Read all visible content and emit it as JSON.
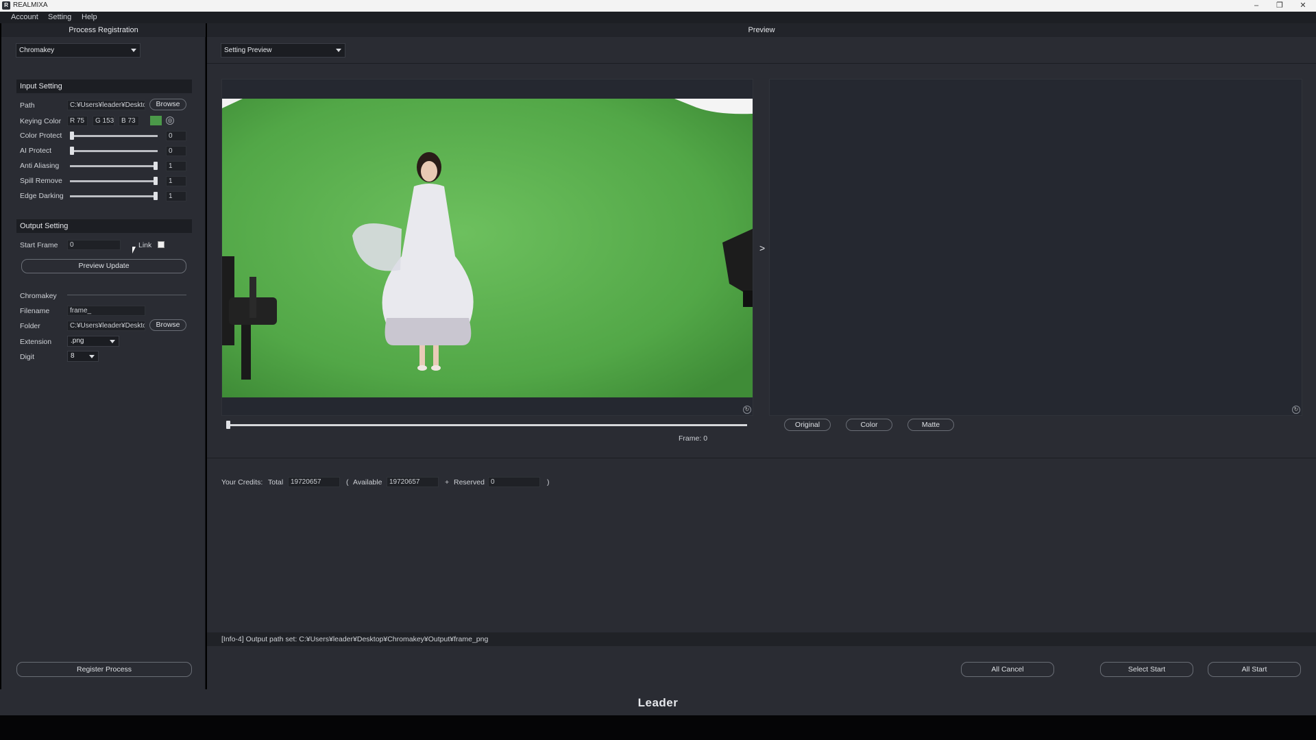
{
  "window": {
    "title": "REALMIXA",
    "icon_letter": "R"
  },
  "menu": [
    "Account",
    "Setting",
    "Help"
  ],
  "left_panel": {
    "header": "Process Registration",
    "mode_select": "Chromakey",
    "input_setting": {
      "title": "Input Setting",
      "path_label": "Path",
      "path_value": "C:¥Users¥leader¥Deskto",
      "browse_label": "Browse",
      "keying_color_label": "Keying Color",
      "r": "R 75",
      "g": "G 153",
      "b": "B 73",
      "swatch_color": "#4b9949",
      "sliders": [
        {
          "label": "Color Protect",
          "value": "0",
          "level": 0
        },
        {
          "label": "AI Protect",
          "value": "0",
          "level": 0
        },
        {
          "label": "Anti Aliasing",
          "value": "1",
          "level": 1
        },
        {
          "label": "Spill Remove",
          "value": "1",
          "level": 1
        },
        {
          "label": "Edge Darking",
          "value": "1",
          "level": 1
        }
      ]
    },
    "output_setting": {
      "title": "Output Setting",
      "start_frame_label": "Start Frame",
      "start_frame_value": "0",
      "link_label": "Link",
      "preview_update_label": "Preview Update",
      "chromakey_label": "Chromakey",
      "filename_label": "Filename",
      "filename_value": "frame_",
      "folder_label": "Folder",
      "folder_value": "C:¥Users¥leader¥Deskto",
      "browse_label": "Browse",
      "extension_label": "Extension",
      "extension_value": ".png",
      "digit_label": "Digit",
      "digit_value": "8"
    },
    "register_label": "Register Process"
  },
  "right_panel": {
    "header": "Preview",
    "preview_select": "Setting Preview",
    "next_arrow": ">",
    "frame_label": "Frame:",
    "frame_value": "0",
    "view_buttons": [
      "Original",
      "Color",
      "Matte"
    ],
    "credits": {
      "label": "Your Credits:",
      "total_label": "Total",
      "total_value": "19720657",
      "open_paren": "(",
      "available_label": "Available",
      "available_value": "19720657",
      "plus": "+",
      "reserved_label": "Reserved",
      "reserved_value": "0",
      "close_paren": ")"
    },
    "log_message": "[Info-4] Output path set: C:¥Users¥leader¥Desktop¥Chromakey¥Output¥frame_png",
    "buttons": {
      "all_cancel": "All Cancel",
      "select_start": "Select Start",
      "all_start": "All Start"
    }
  },
  "footer": {
    "brand": "Leader"
  },
  "colors": {
    "chroma_green": "#5fb453",
    "panel": "#2a2c33",
    "section": "#1c1e23"
  }
}
